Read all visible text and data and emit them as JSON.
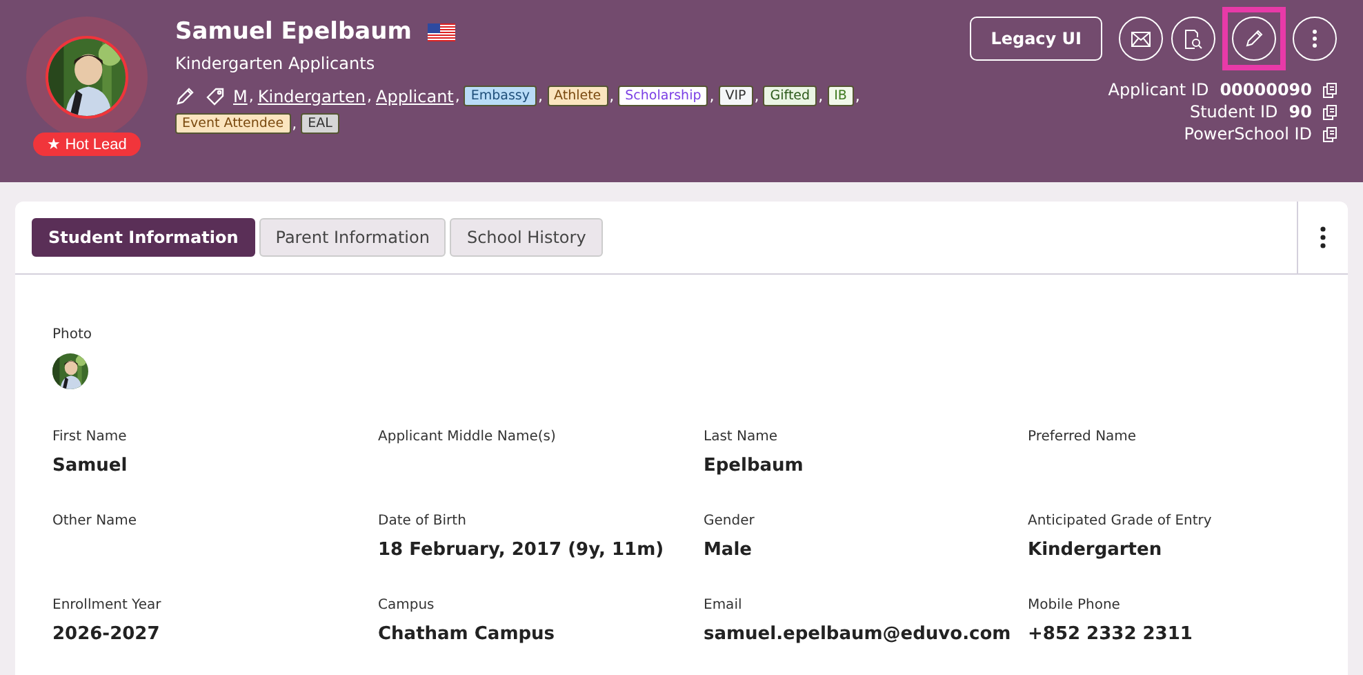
{
  "header": {
    "name": "Samuel Epelbaum",
    "group": "Kindergarten Applicants",
    "badge": "★ Hot Lead",
    "separator": ",",
    "links": [
      "M",
      "Kindergarten",
      "Applicant"
    ],
    "tags": [
      {
        "label": "Embassy",
        "color": "#b9dcf7"
      },
      {
        "label": "Athlete",
        "color": "#fbe5bf"
      },
      {
        "label": "Scholarship",
        "color": "#ffffff"
      },
      {
        "label": "VIP",
        "color": "#f4f6f8"
      },
      {
        "label": "Gifted",
        "color": "#eaf5e4"
      },
      {
        "label": "IB",
        "color": "#f1f9ea"
      },
      {
        "label": "Event Attendee",
        "color": "#fbe5bf"
      },
      {
        "label": "EAL",
        "color": "#d6d6d6"
      }
    ],
    "legacy_button": "Legacy UI",
    "edit_highlighted": true,
    "ids": [
      {
        "label": "Applicant ID",
        "value": "00000090"
      },
      {
        "label": "Student ID",
        "value": "90"
      },
      {
        "label": "PowerSchool ID"
      }
    ]
  },
  "tabs": [
    {
      "label": "Student Information",
      "selected": true
    },
    {
      "label": "Parent Information",
      "selected": false
    },
    {
      "label": "School History",
      "selected": false
    }
  ],
  "photo_label": "Photo",
  "fields": [
    {
      "label": "First Name",
      "value": "Samuel"
    },
    {
      "label": "Applicant Middle Name(s)"
    },
    {
      "label": "Last Name",
      "value": "Epelbaum"
    },
    {
      "label": "Preferred Name"
    },
    {
      "label": "Other Name"
    },
    {
      "label": "Date of Birth",
      "value": "18 February, 2017 (9y, 11m)"
    },
    {
      "label": "Gender",
      "value": "Male"
    },
    {
      "label": "Anticipated Grade of Entry",
      "value": "Kindergarten"
    },
    {
      "label": "Enrollment Year",
      "value": "2026-2027"
    },
    {
      "label": "Campus",
      "value": "Chatham Campus"
    },
    {
      "label": "Email",
      "value": "samuel.epelbaum@eduvo.com"
    },
    {
      "label": "Mobile Phone",
      "value": "+852 2332 2311"
    }
  ]
}
